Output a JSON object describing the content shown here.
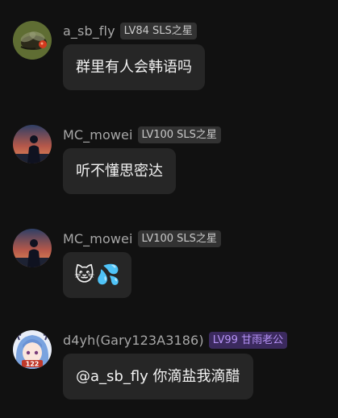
{
  "messages": [
    {
      "username": "a_sb_fly",
      "badge": "LV84 SLS之星",
      "text": "群里有人会韩语吗",
      "avatar": "fly-photo-avatar"
    },
    {
      "username": "MC_mowei",
      "badge": "LV100 SLS之星",
      "text": "听不懂思密达",
      "avatar": "sunset-silhouette-avatar"
    },
    {
      "username": "MC_mowei",
      "badge": "LV100 SLS之星",
      "emojis": [
        "🐱",
        "💦"
      ],
      "avatar": "sunset-silhouette-avatar"
    },
    {
      "username": "d4yh(Gary123A3186)",
      "badge": "LV99 甘雨老公",
      "text": "@a_sb_fly 你滴盐我滴醋",
      "avatar": "anime-girl-avatar",
      "avatar_text": "122"
    }
  ],
  "colors": {
    "background": "#111111",
    "bubble": "#262626",
    "badge_default": "#323232",
    "badge_purple_bg": "#3b2a5e",
    "badge_purple_text": "#b692f6"
  }
}
